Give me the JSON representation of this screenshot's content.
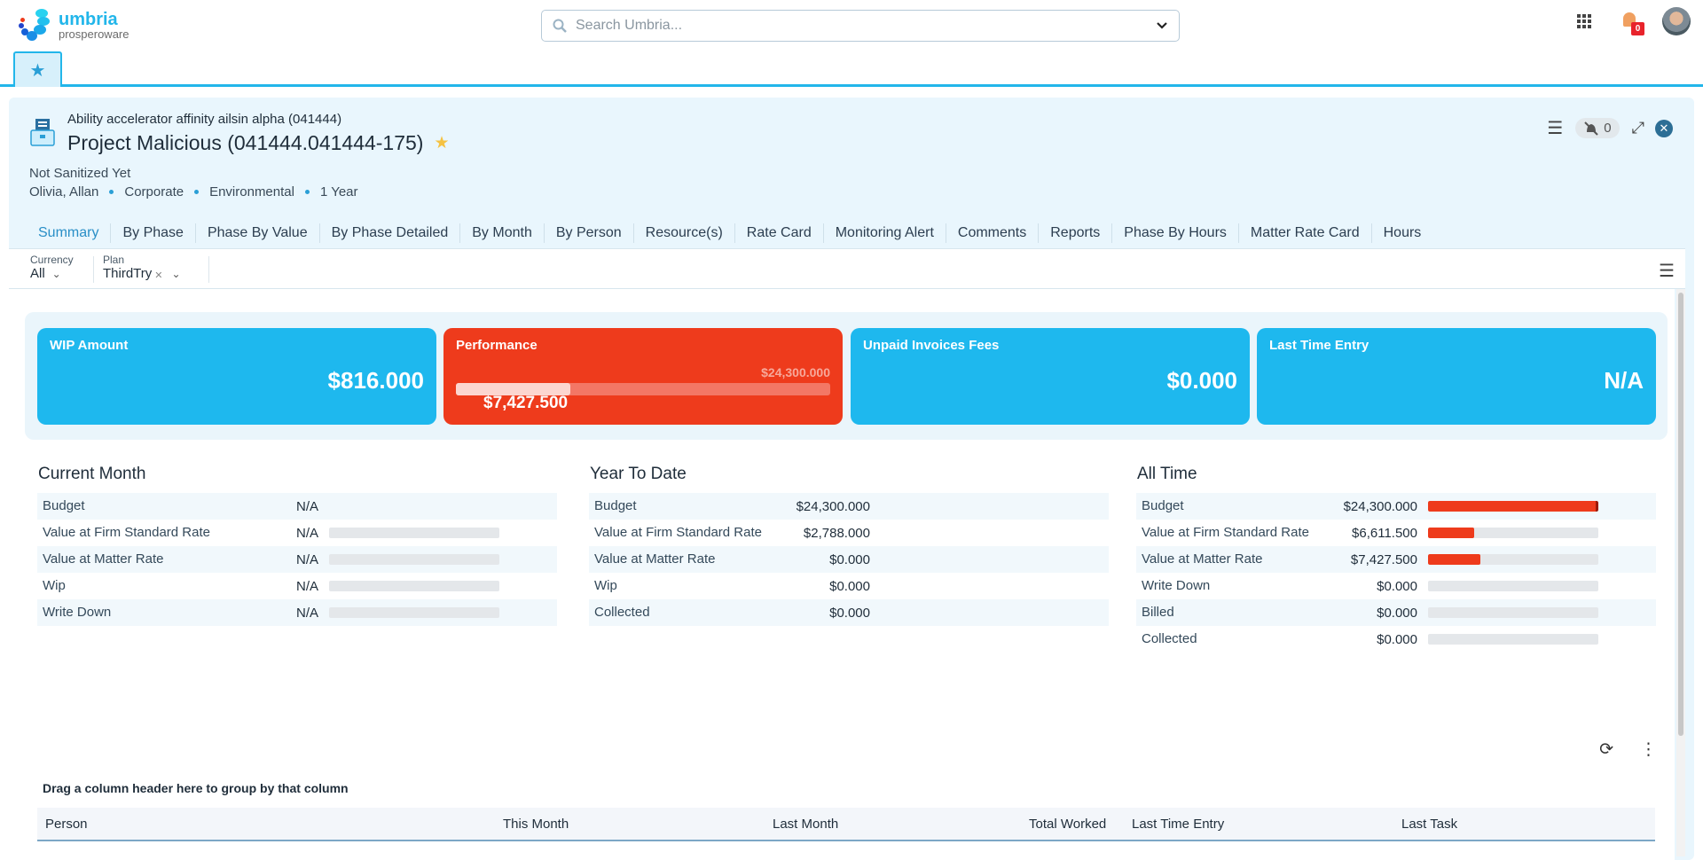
{
  "app": {
    "brand": "umbria",
    "brand_sub": "prosperoware"
  },
  "search": {
    "placeholder": "Search Umbria..."
  },
  "notifications": {
    "count": "0"
  },
  "header": {
    "parent": "Ability accelerator affinity ailsin alpha (041444)",
    "title": "Project Malicious (041444.041444-175)",
    "status": "Not Sanitized Yet",
    "meta": [
      "Olivia, Allan",
      "Corporate",
      "Environmental",
      "1 Year"
    ],
    "alert_count": "0"
  },
  "tabs": [
    {
      "label": "Summary",
      "active": true
    },
    {
      "label": "By Phase"
    },
    {
      "label": "Phase By Value"
    },
    {
      "label": "By Phase Detailed"
    },
    {
      "label": "By Month"
    },
    {
      "label": "By Person"
    },
    {
      "label": "Resource(s)"
    },
    {
      "label": "Rate Card"
    },
    {
      "label": "Monitoring Alert"
    },
    {
      "label": "Comments"
    },
    {
      "label": "Reports"
    },
    {
      "label": "Phase By Hours"
    },
    {
      "label": "Matter Rate Card"
    },
    {
      "label": "Hours"
    }
  ],
  "filters": {
    "currency": {
      "label": "Currency",
      "value": "All"
    },
    "plan": {
      "label": "Plan",
      "value": "ThirdTry"
    }
  },
  "kpis": {
    "wip": {
      "title": "WIP Amount",
      "value": "$816.000"
    },
    "performance": {
      "title": "Performance",
      "target": "$24,300.000",
      "value": "$7,427.500",
      "progress_fraction": 0.306
    },
    "unpaid": {
      "title": "Unpaid Invoices Fees",
      "value": "$0.000"
    },
    "last_entry": {
      "title": "Last Time Entry",
      "value": "N/A"
    }
  },
  "current_month": {
    "title": "Current Month",
    "rows": [
      {
        "label": "Budget",
        "value": "N/A"
      },
      {
        "label": "Value at Firm Standard Rate",
        "value": "N/A",
        "fraction": 0
      },
      {
        "label": "Value at Matter Rate",
        "value": "N/A",
        "fraction": 0
      },
      {
        "label": "Wip",
        "value": "N/A",
        "fraction": 0
      },
      {
        "label": "Write Down",
        "value": "N/A",
        "fraction": 0
      }
    ]
  },
  "year_to_date": {
    "title": "Year To Date",
    "rows": [
      {
        "label": "Budget",
        "value": "$24,300.000"
      },
      {
        "label": "Value at Firm Standard Rate",
        "value": "$2,788.000"
      },
      {
        "label": "Value at Matter Rate",
        "value": "$0.000"
      },
      {
        "label": "Wip",
        "value": "$0.000"
      },
      {
        "label": "Collected",
        "value": "$0.000"
      }
    ]
  },
  "all_time": {
    "title": "All Time",
    "rows": [
      {
        "label": "Budget",
        "value": "$24,300.000",
        "fraction": 1.0
      },
      {
        "label": "Value at Firm Standard Rate",
        "value": "$6,611.500",
        "fraction": 0.272
      },
      {
        "label": "Value at Matter Rate",
        "value": "$7,427.500",
        "fraction": 0.306
      },
      {
        "label": "Write Down",
        "value": "$0.000",
        "fraction": 0
      },
      {
        "label": "Billed",
        "value": "$0.000",
        "fraction": 0
      },
      {
        "label": "Collected",
        "value": "$0.000",
        "fraction": 0
      }
    ]
  },
  "grid": {
    "group_hint": "Drag a column header here to group by that column",
    "columns": [
      "Person",
      "This Month",
      "Last Month",
      "Total Worked",
      "Last Time Entry",
      "Last Task"
    ]
  }
}
